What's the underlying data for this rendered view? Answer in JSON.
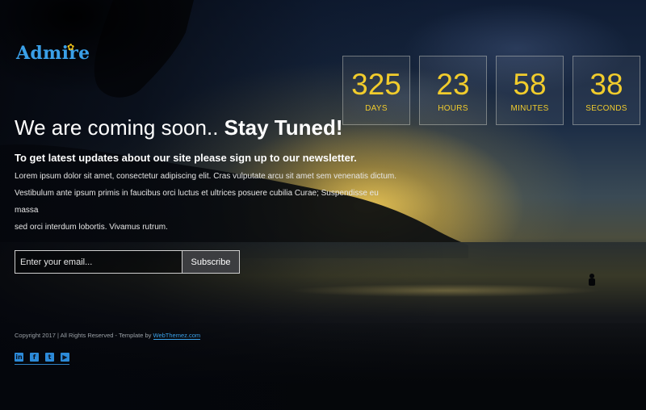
{
  "brand": {
    "name": "Admire"
  },
  "hero": {
    "headline_light": "We are coming soon..",
    "headline_bold": "Stay Tuned!",
    "subhead": "To get latest updates about our site please sign up to our newsletter.",
    "body_lines": [
      "Lorem ipsum dolor sit amet, consectetur adipiscing elit. Cras vulputate arcu sit amet sem venenatis dictum.",
      "Vestibulum ante ipsum primis in faucibus orci luctus et ultrices posuere cubilia Curae; Suspendisse eu massa",
      "sed orci interdum lobortis. Vivamus rutrum."
    ]
  },
  "newsletter": {
    "email_placeholder": "Enter your email...",
    "email_value": "",
    "subscribe_label": "Subscribe"
  },
  "countdown": [
    {
      "value": "325",
      "label": "DAYS"
    },
    {
      "value": "23",
      "label": "HOURS"
    },
    {
      "value": "58",
      "label": "MINUTES"
    },
    {
      "value": "38",
      "label": "SECONDS"
    }
  ],
  "footer": {
    "copyright": "Copyright 2017 | All Rights Reserved - Template by",
    "credit_link": "WebThemez.com",
    "social": [
      {
        "icon": "linkedin-icon",
        "glyph": "in"
      },
      {
        "icon": "facebook-icon",
        "glyph": "f"
      },
      {
        "icon": "twitter-icon",
        "glyph": "t"
      },
      {
        "icon": "youtube-icon",
        "glyph": "▶"
      }
    ]
  },
  "colors": {
    "accent_blue": "#3aa0e8",
    "countdown_yellow": "#f1cc2c",
    "logo_flower": "#f2c318"
  }
}
